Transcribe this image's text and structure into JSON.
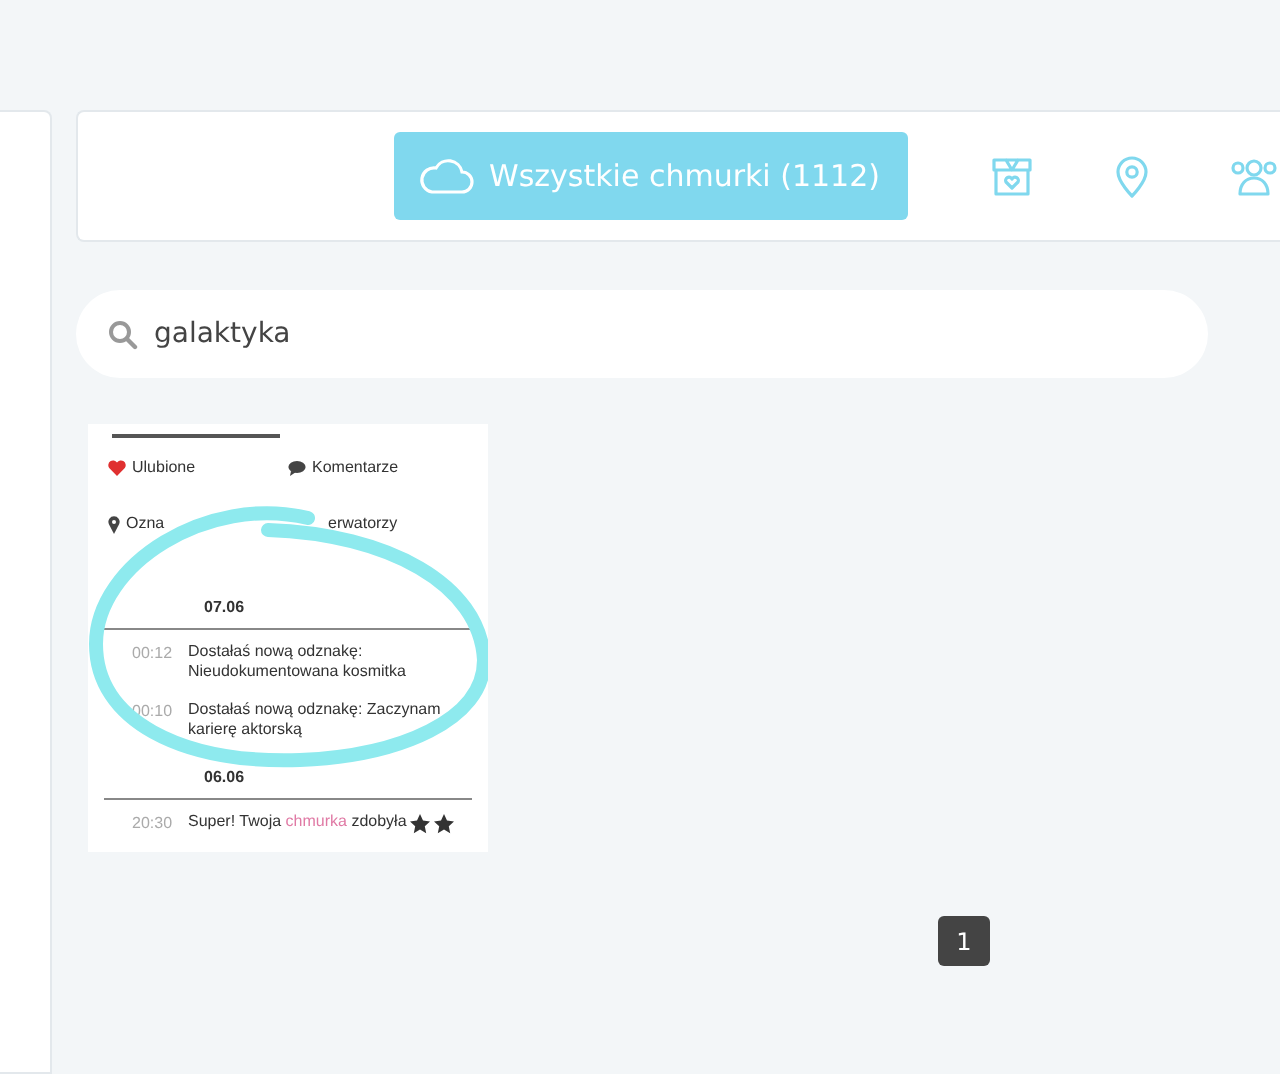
{
  "toolbar": {
    "all_button": {
      "label": "Wszystkie chmurki (1112)",
      "selected": true
    }
  },
  "search": {
    "value": "galaktyka"
  },
  "results": [
    {
      "kind": "screenshot",
      "tabs": [
        {
          "label": "Ulubione"
        },
        {
          "label": "Komentarze"
        }
      ],
      "tabs2": [
        {
          "label": "Ozna"
        },
        {
          "label": "erwatorzy"
        }
      ],
      "days": [
        {
          "date": "07.06",
          "entries": [
            {
              "kind": "badge",
              "time": "00:12",
              "text": "Dostałaś nową odznakę: Nieudokumentowana kosmitka"
            },
            {
              "kind": "badge",
              "time": "00:10",
              "text": "Dostałaś nową odznakę: Zaczynam karierę aktorską"
            }
          ]
        },
        {
          "date": "06.06",
          "entries": [
            {
              "kind": "award",
              "time": "20:30",
              "text": "Super! Twoja **chmurka** zdobyła"
            }
          ]
        }
      ]
    }
  ],
  "pagination": [
    {
      "label": "1",
      "selected": true
    }
  ]
}
